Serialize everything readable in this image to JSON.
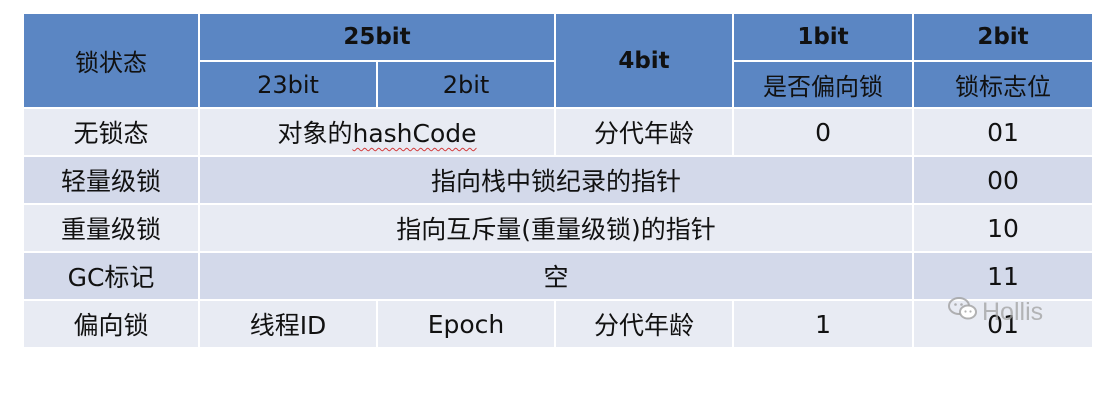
{
  "header": {
    "state": "锁状态",
    "bits25": "25bit",
    "bits23": "23bit",
    "bits2": "2bit",
    "bits4": "4bit",
    "bits1": "1bit",
    "bits2_lock": "2bit",
    "biased_flag": "是否偏向锁",
    "lock_flag": "锁标志位"
  },
  "rows": [
    {
      "state": "无锁态",
      "hash_prefix": "对象的",
      "hash_code": "hashCode",
      "age": "分代年龄",
      "biased": "0",
      "flag": "01"
    },
    {
      "state": "轻量级锁",
      "content": "指向栈中锁纪录的指针",
      "flag": "00"
    },
    {
      "state": "重量级锁",
      "content": "指向互斥量(重量级锁)的指针",
      "flag": "10"
    },
    {
      "state": "GC标记",
      "content": "空",
      "flag": "11"
    },
    {
      "state": "偏向锁",
      "thread": "线程ID",
      "epoch": "Epoch",
      "age": "分代年龄",
      "biased": "1",
      "flag": "01"
    }
  ],
  "watermark": "Hollis",
  "colors": {
    "header": "#5b86c3",
    "row_light": "#e8ebf3",
    "row_dark": "#d3d9ea"
  }
}
